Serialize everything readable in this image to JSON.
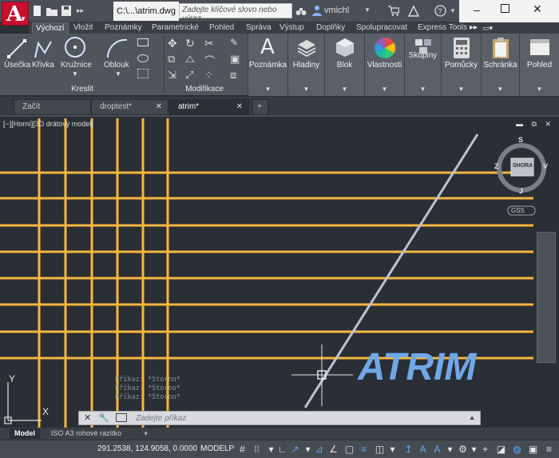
{
  "app": {
    "logo_letter": "A",
    "file_title": "C:\\...\\atrim.dwg",
    "search_placeholder": "Zadejte klíčové slovo nebo výraz",
    "username": "vmichl"
  },
  "ribbon_tabs": [
    {
      "label": "Výchozí",
      "active": true
    },
    {
      "label": "Vložit"
    },
    {
      "label": "Poznámky"
    },
    {
      "label": "Parametrické"
    },
    {
      "label": "Pohled"
    },
    {
      "label": "Správa"
    },
    {
      "label": "Výstup"
    },
    {
      "label": "Doplňky"
    },
    {
      "label": "Spolupracovat"
    },
    {
      "label": "Express Tools"
    }
  ],
  "ribbon": {
    "draw_tools": [
      "Úsečka",
      "Křivka",
      "Kružnice",
      "Oblouk"
    ],
    "draw_panel": "Kreslit",
    "modify_panel": "Modifikace",
    "big_buttons": [
      "Poznámka",
      "Hladiny",
      "Blok",
      "Vlastnosti",
      "Skupiny",
      "Pomůcky",
      "Schránka",
      "Pohled"
    ]
  },
  "doc_tabs": [
    {
      "label": "Začít"
    },
    {
      "label": "droptest*"
    },
    {
      "label": "atrim*",
      "active": true
    }
  ],
  "viewport": {
    "label": "[−][Horní][3D drátový model]",
    "viewcube": {
      "top": "S",
      "left": "Z",
      "right": "V",
      "bottom": "J",
      "face": "SHORA",
      "ucs": "GSS"
    },
    "text_object": "ATRIM",
    "ucs_y": "Y",
    "ucs_x": "X",
    "colors": {
      "grid_line": "#f5b73e",
      "text": "#6fa8e8",
      "diagonal": "#b8c4d4"
    }
  },
  "command": {
    "history": [
      "Příkaz: *Storno*",
      "Příkaz: *Storno*",
      "Příkaz: *Storno*"
    ],
    "placeholder": "Zadejte příkaz"
  },
  "layout_tabs": [
    {
      "label": "Model",
      "active": true
    },
    {
      "label": "ISO A3 rohové razítko"
    }
  ],
  "status": {
    "coordinates": "291.2538, 124.9058, 0.0000",
    "space": "MODELP"
  }
}
